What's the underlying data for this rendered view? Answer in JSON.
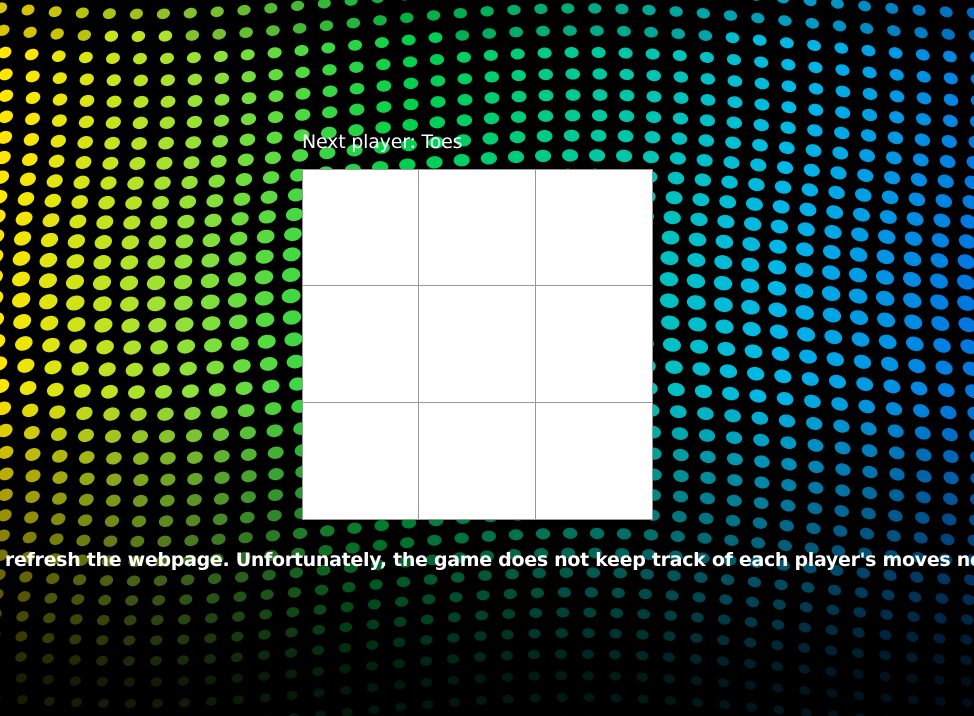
{
  "game": {
    "status": "Next player: Toes",
    "board": [
      "",
      "",
      "",
      "",
      "",
      "",
      "",
      "",
      ""
    ]
  },
  "instructions": {
    "text": "e refresh the webpage. Unfortunately, the game does not keep track of each player's moves nor w"
  },
  "background": {
    "kind": "dot-wave pattern",
    "colors": [
      "#ffe600",
      "#8fe03a",
      "#00d04a",
      "#00c8a0",
      "#00b8e8",
      "#0078e0"
    ]
  }
}
